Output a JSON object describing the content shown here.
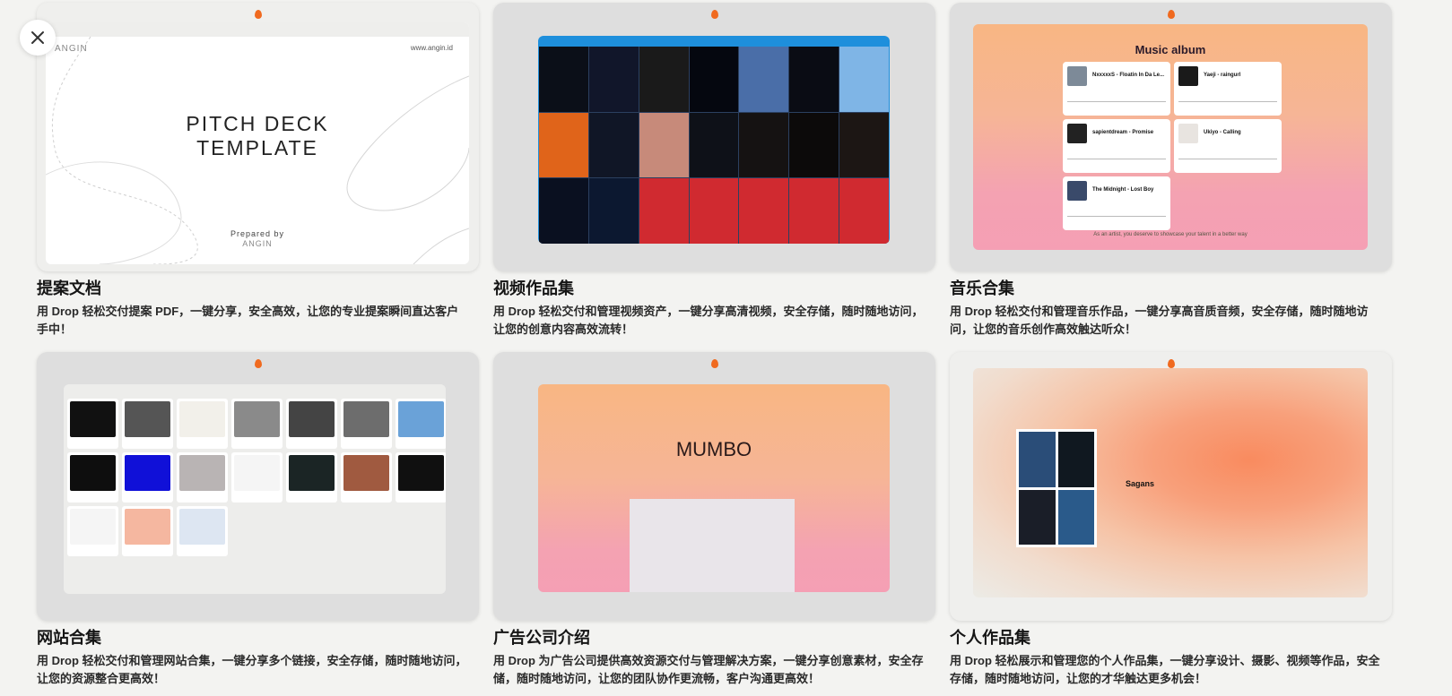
{
  "close_button_label": "×",
  "cards": [
    {
      "title": "提案文档",
      "desc": "用 Drop 轻松交付提案 PDF，一键分享，安全高效，让您的专业提案瞬间直达客户手中！",
      "preview": {
        "main_line1": "PITCH DECK",
        "main_line2": "TEMPLATE",
        "logo": "ANGIN",
        "url": "www.angin.id",
        "prepared": "Prepared by",
        "prepared_logo": "ANGIN"
      }
    },
    {
      "title": "视频作品集",
      "desc": "用 Drop 轻松交付和管理视频资产，一键分享高清视频，安全存储，随时随地访问，让您的创意内容高效流转！"
    },
    {
      "title": "音乐合集",
      "desc": "用 Drop 轻松交付和管理音乐作品，一键分享高音质音频，安全存储，随时随地访问，让您的音乐创作高效触达听众！",
      "preview": {
        "heading": "Music album",
        "tracks": [
          "NxxxxxS - Floatin In Da Le...",
          "Yaeji - raingurl",
          "sapientdream - Promise",
          "Ukiyo - Calling",
          "The Midnight - Lost Boy"
        ],
        "footer": "As an artist, you deserve to showcase your talent in a better way"
      }
    },
    {
      "title": "网站合集",
      "desc": "用 Drop 轻松交付和管理网站合集，一键分享多个链接，安全存储，随时随地访问，让您的资源整合更高效！"
    },
    {
      "title": "广告公司介绍",
      "desc": "用 Drop 为广告公司提供高效资源交付与管理解决方案，一键分享创意素材，安全存储，随时随地访问，让您的团队协作更流畅，客户沟通更高效！",
      "preview": {
        "heading": "MUMBO"
      }
    },
    {
      "title": "个人作品集",
      "desc": "用 Drop 轻松展示和管理您的个人作品集，一键分享设计、摄影、视频等作品，安全存储，随时随地访问，让您的才华触达更多机会！",
      "preview": {
        "name": "Sagans"
      }
    }
  ],
  "colors": {
    "background": "#f3f3f1",
    "drop_accent": "#f06a1f"
  },
  "icons": [
    "close-icon",
    "drop-logo-icon"
  ]
}
